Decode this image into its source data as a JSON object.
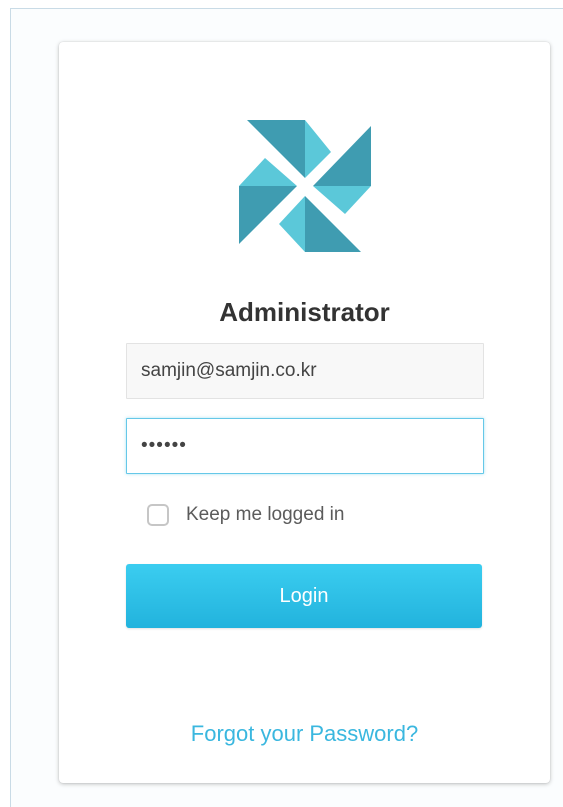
{
  "login": {
    "title": "Administrator",
    "email_value": "samjin@samjin.co.kr",
    "password_value": "••••••",
    "remember_label": "Keep me logged in",
    "login_label": "Login",
    "forgot_label": "Forgot your Password?"
  },
  "icons": {
    "logo": "pinwheel-logo-icon",
    "checkbox": "checkbox-unchecked-icon"
  },
  "colors": {
    "accent": "#2bbde4",
    "logo_dark": "#3f9cb1",
    "logo_light": "#5bc8d9",
    "link": "#3ab7df",
    "input_focus_border": "#66c8e8"
  }
}
